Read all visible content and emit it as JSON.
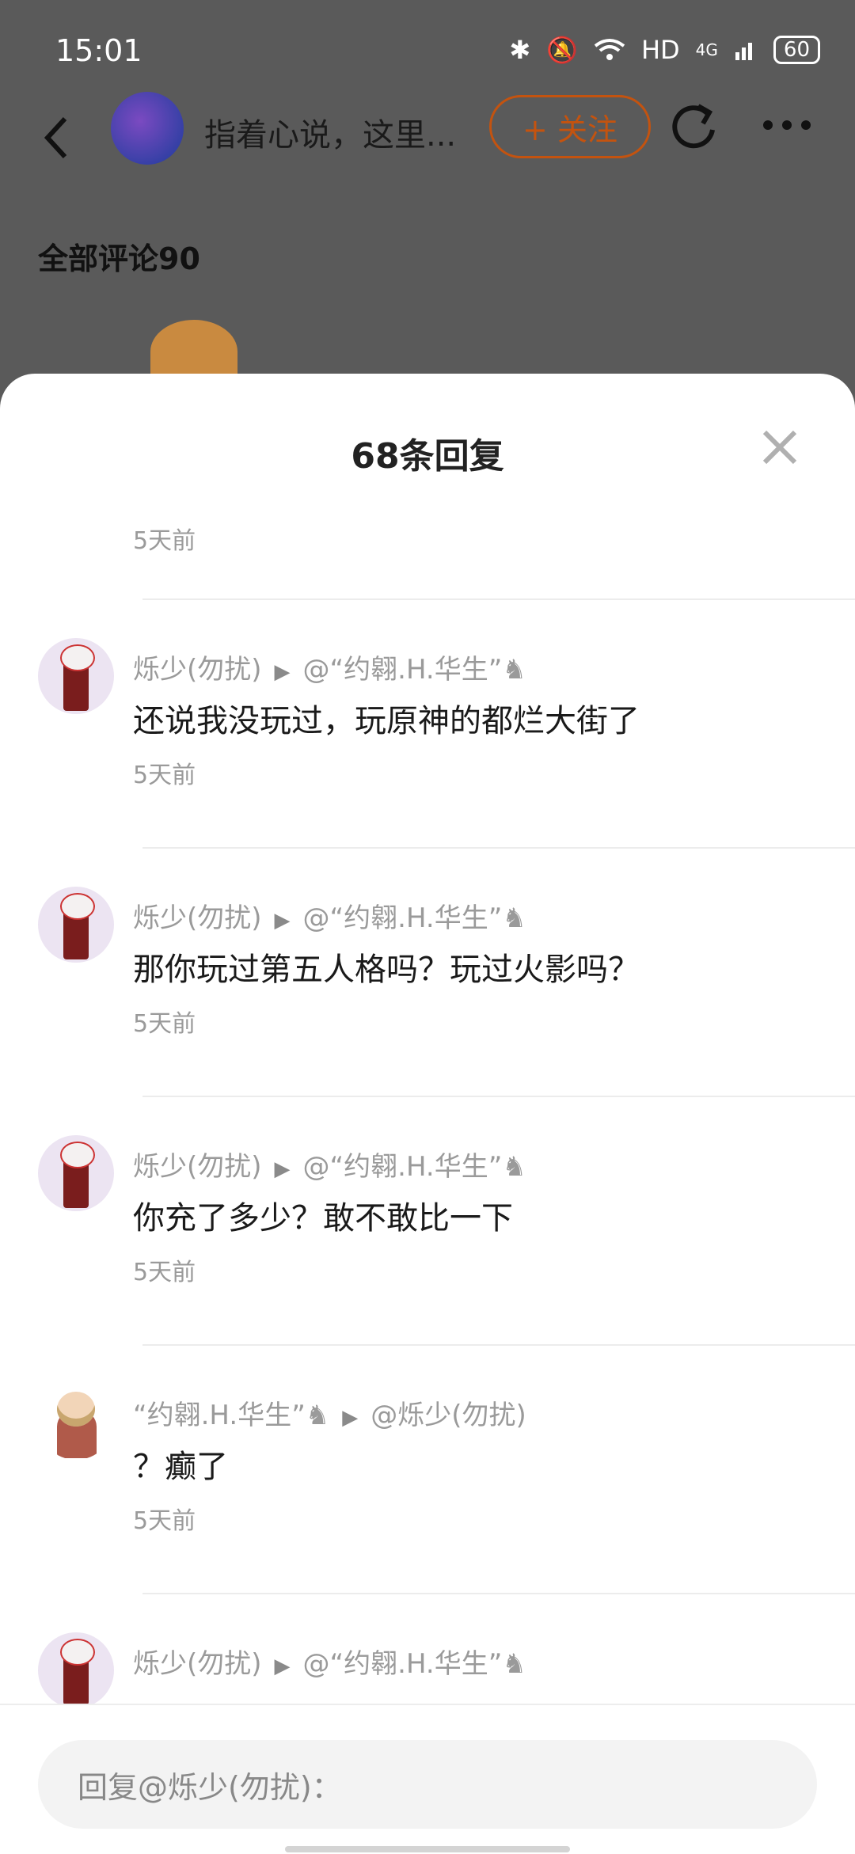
{
  "status": {
    "time": "15:01",
    "network": "HD",
    "signal": "4G",
    "battery": "60"
  },
  "header": {
    "title": "指着心说，这里...",
    "follow_label": "+ 关注"
  },
  "section_title": "全部评论90",
  "sheet": {
    "title": "68条回复",
    "first_time": "5天前",
    "rows": [
      {
        "user": "烁少(勿扰)",
        "reply_to": "@“约翱.H.华生”♞",
        "content": "还说我没玩过，玩原神的都烂大街了",
        "time": "5天前"
      },
      {
        "user": "烁少(勿扰)",
        "reply_to": "@“约翱.H.华生”♞",
        "content": "那你玩过第五人格吗？玩过火影吗？",
        "time": "5天前"
      },
      {
        "user": "烁少(勿扰)",
        "reply_to": "@“约翱.H.华生”♞",
        "content": "你充了多少？敢不敢比一下",
        "time": "5天前"
      },
      {
        "user": "“约翱.H.华生”♞",
        "reply_to": "@烁少(勿扰)",
        "content": "？癫了",
        "time": "5天前"
      },
      {
        "user": "烁少(勿扰)",
        "reply_to": "@“约翱.H.华生”♞",
        "content": "",
        "time": ""
      }
    ]
  },
  "reply_input": {
    "placeholder": "回复@烁少(勿扰)："
  }
}
